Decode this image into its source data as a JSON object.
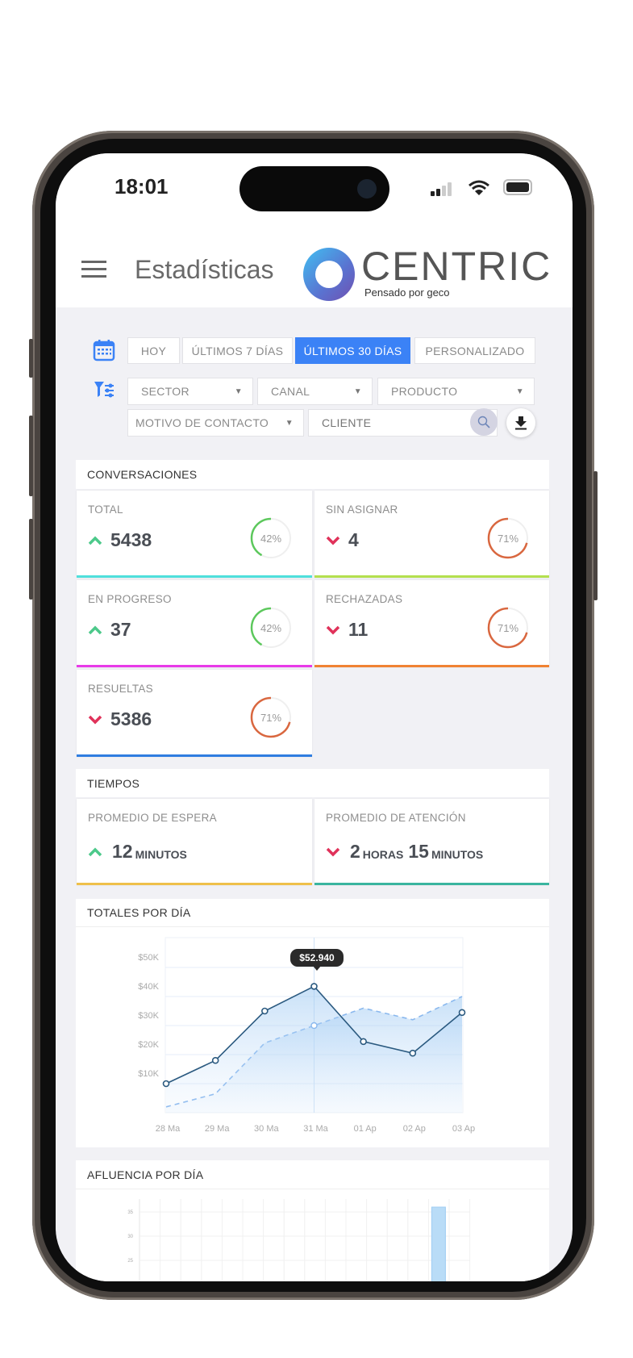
{
  "status_bar": {
    "time": "18:01",
    "icons": [
      "signal-icon",
      "wifi-icon",
      "battery-icon"
    ]
  },
  "header": {
    "menu_icon": "hamburger-icon",
    "title": "Estadísticas",
    "logo": {
      "name": "CENTRIC",
      "tagline": "Pensado por geco"
    }
  },
  "date_filter": {
    "icon": "calendar-icon",
    "options": [
      {
        "label": "HOY"
      },
      {
        "label": "ÚLTIMOS 7 DÍAS"
      },
      {
        "label": "ÚLTIMOS 30 DÍAS",
        "active": true
      },
      {
        "label": "PERSONALIZADO"
      }
    ],
    "active_color": "#3b82f6"
  },
  "filters": {
    "icon": "filter-icon",
    "sector": "SECTOR",
    "canal": "CANAL",
    "producto": "PRODUCTO",
    "motivo": "MOTIVO DE CONTACTO",
    "cliente_placeholder": "CLIENTE",
    "search_icon": "search-icon",
    "download_icon": "download-icon"
  },
  "conversaciones": {
    "title": "CONVERSACIONES",
    "cards": [
      {
        "label": "TOTAL",
        "value": "5438",
        "trend": "up",
        "percent": 42,
        "percent_label": "42%",
        "ring_color": "#5cc85c",
        "bar_color": "#4fe0dc"
      },
      {
        "label": "SIN ASIGNAR",
        "value": "4",
        "trend": "down",
        "percent": 71,
        "percent_label": "71%",
        "ring_color": "#d9673f",
        "bar_color": "#b4e04f"
      },
      {
        "label": "EN PROGRESO",
        "value": "37",
        "trend": "up",
        "percent": 42,
        "percent_label": "42%",
        "ring_color": "#5cc85c",
        "bar_color": "#e83ae8"
      },
      {
        "label": "RECHAZADAS",
        "value": "11",
        "trend": "down",
        "percent": 71,
        "percent_label": "71%",
        "ring_color": "#d9673f",
        "bar_color": "#f08233"
      },
      {
        "label": "RESUELTAS",
        "value": "5386",
        "trend": "down",
        "percent": 71,
        "percent_label": "71%",
        "ring_color": "#d9673f",
        "bar_color": "#2f7de0"
      }
    ]
  },
  "tiempos": {
    "title": "TIEMPOS",
    "cards": [
      {
        "label": "PROMEDIO DE ESPERA",
        "trend": "up",
        "parts": [
          {
            "n": "12",
            "u": "MINUTOS"
          }
        ],
        "bar_color": "#efc04a"
      },
      {
        "label": "PROMEDIO DE ATENCIÓN",
        "trend": "down",
        "parts": [
          {
            "n": "2",
            "u": "HORAS"
          },
          {
            "n": "15",
            "u": "MINUTOS"
          }
        ],
        "bar_color": "#3ab59f"
      }
    ]
  },
  "trend_colors": {
    "up": "#4cc98a",
    "down": "#e0325a"
  },
  "chart_data": [
    {
      "type": "line",
      "title": "TOTALES POR DÍA",
      "categories": [
        "28 Ma",
        "29 Ma",
        "30 Ma",
        "31 Ma",
        "01 Ap",
        "02 Ap",
        "03 Ap"
      ],
      "yticks": [
        "$10K",
        "$20K",
        "$30K",
        "$40K",
        "$50K"
      ],
      "ylim": [
        0,
        50000
      ],
      "grid": true,
      "tooltip": {
        "category": "31 Ma",
        "label": "$52.940"
      },
      "series": [
        {
          "style": "solid",
          "color": "#2b5a80",
          "values": [
            10000,
            18000,
            35000,
            43500,
            24500,
            20500,
            34500
          ]
        },
        {
          "style": "dashed",
          "color": "#8ab8ee",
          "values": [
            2000,
            6500,
            24000,
            30000,
            36000,
            32000,
            40000
          ]
        }
      ]
    },
    {
      "type": "bar",
      "title": "AFLUENCIA POR DÍA",
      "yticks": [
        "20",
        "25",
        "30",
        "35"
      ],
      "grid": true,
      "color": "#b9dcf7",
      "visible_bars": [
        {
          "index": 14,
          "value": 36
        }
      ]
    }
  ]
}
